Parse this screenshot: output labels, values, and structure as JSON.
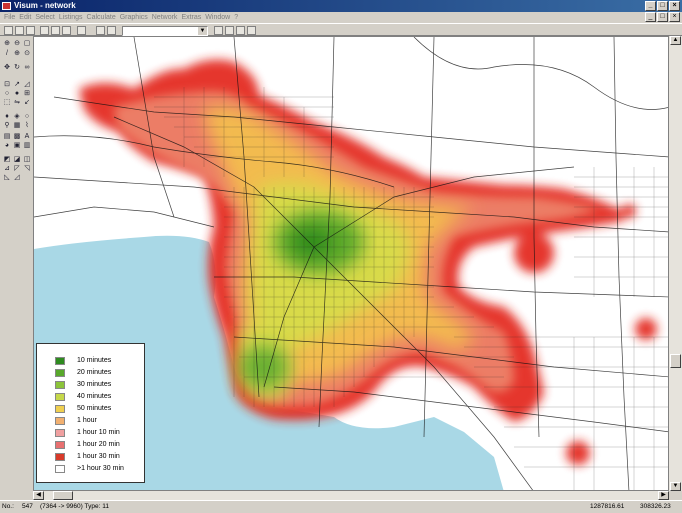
{
  "window": {
    "title": "Visum - network",
    "buttons": [
      "_",
      "□",
      "×"
    ],
    "mdi_buttons": [
      "_",
      "□",
      "×"
    ]
  },
  "menu": [
    "File",
    "Edit",
    "Select",
    "Listings",
    "Calculate",
    "Graphics",
    "Network",
    "Extras",
    "Window",
    "?"
  ],
  "legend": {
    "items": [
      {
        "label": "10 minutes",
        "color": "#2e8b1f"
      },
      {
        "label": "20 minutes",
        "color": "#58a82b"
      },
      {
        "label": "30 minutes",
        "color": "#8cc43a"
      },
      {
        "label": "40 minutes",
        "color": "#c6d84a"
      },
      {
        "label": "50 minutes",
        "color": "#f0d050"
      },
      {
        "label": "1 hour",
        "color": "#f2b070"
      },
      {
        "label": "1 hour 10 min",
        "color": "#f0a0a0"
      },
      {
        "label": "1 hour 20 min",
        "color": "#e87070"
      },
      {
        "label": "1 hour 30 min",
        "color": "#d83a2a"
      },
      {
        "label": ">1 hour 30 min",
        "color": "#ffffff"
      }
    ]
  },
  "status": {
    "field1": "No.:",
    "field2": "547",
    "field3": "(7364 -> 9960)  Type: 11",
    "coord_x": "1287816.61",
    "coord_y": "308326.23"
  },
  "colors": {
    "water": "#a9d8e6",
    "red_zone": "#e02010",
    "green_core": "#3c9a22"
  }
}
